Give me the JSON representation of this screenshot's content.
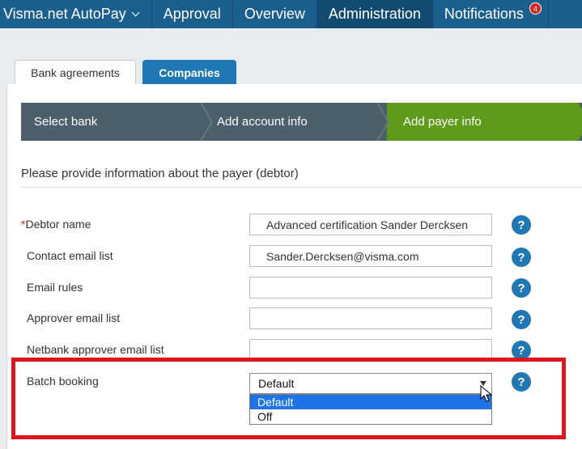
{
  "nav": {
    "brand": "Visma.net AutoPay",
    "items": [
      "Approval",
      "Overview",
      "Administration",
      "Notifications"
    ],
    "notification_count": "4"
  },
  "tabs": [
    "Bank agreements",
    "Companies"
  ],
  "wizard": {
    "steps": [
      "Select bank",
      "Add account info",
      "Add payer info"
    ]
  },
  "intro": "Please provide information about the payer (debtor)",
  "form": {
    "required_mark": "*",
    "debtor_name_label": "Debtor name",
    "debtor_name_value": "Advanced certification Sander Dercksen",
    "contact_email_label": "Contact email list",
    "contact_email_value": "Sander.Dercksen@visma.com",
    "email_rules_label": "Email rules",
    "approver_email_label": "Approver email list",
    "netbank_approver_label": "Netbank approver email list",
    "batch_booking_label": "Batch booking",
    "batch_booking_value": "Default",
    "batch_booking_options": [
      "Default",
      "Off"
    ],
    "help_glyph": "?"
  },
  "colors": {
    "nav_bg": "#1a5f8e",
    "wizard_bg": "#4c5f6b",
    "wizard_active": "#5f9b1a",
    "accent": "#1f78b4",
    "highlight": "#e0141c"
  }
}
